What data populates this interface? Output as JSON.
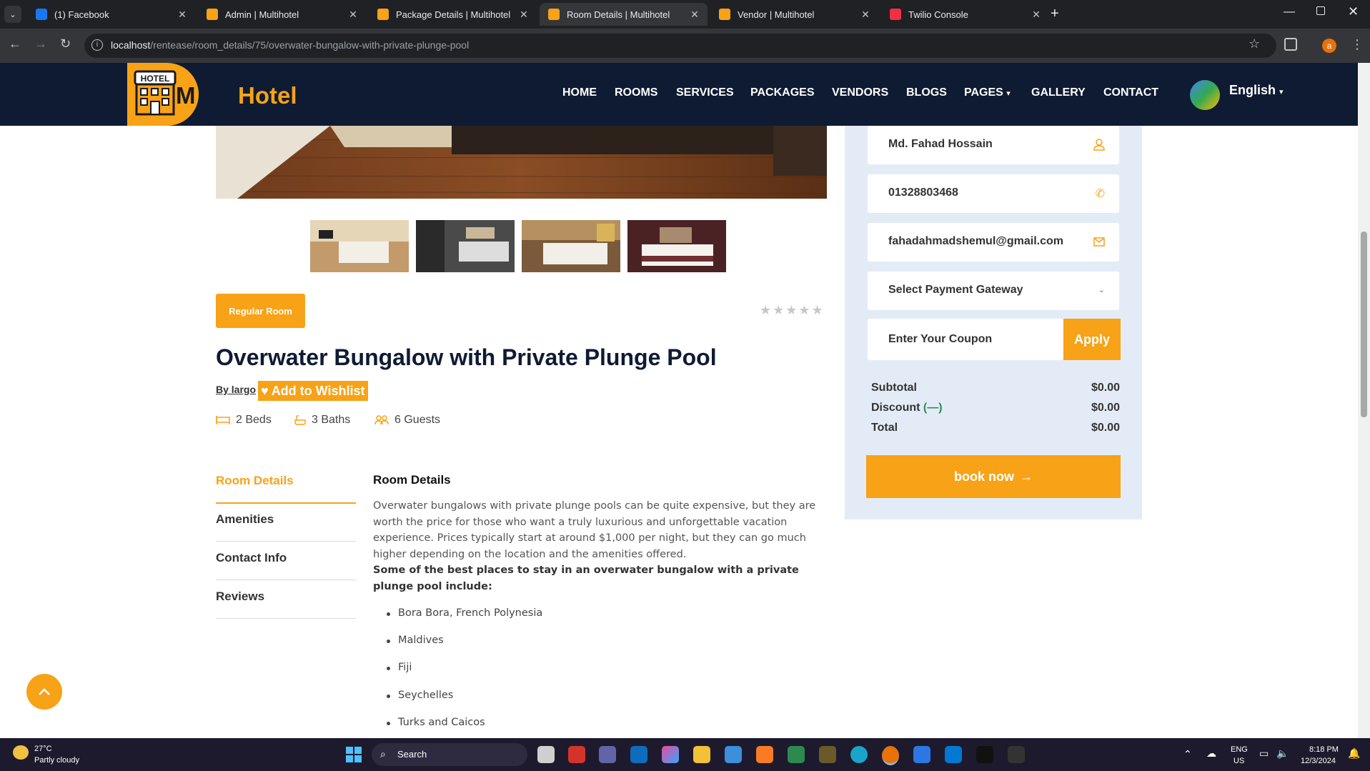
{
  "browser": {
    "tabs": [
      {
        "label": "(1) Facebook",
        "color": "#1877f2"
      },
      {
        "label": "Admin | Multihotel",
        "color": "#f8a217"
      },
      {
        "label": "Package Details | Multihotel",
        "color": "#f8a217"
      },
      {
        "label": "Room Details | Multihotel",
        "color": "#f8a217",
        "active": true
      },
      {
        "label": "Vendor | Multihotel",
        "color": "#f8a217"
      },
      {
        "label": "Twilio Console",
        "color": "#f22f46"
      }
    ],
    "url_host": "localhost",
    "url_path": "/rentease/room_details/75/overwater-bungalow-with-private-plunge-pool",
    "profile_initial": "a"
  },
  "site": {
    "logo_badge": "HOTEL",
    "logo_text": "Hotel",
    "nav": [
      "HOME",
      "ROOMS",
      "SERVICES",
      "PACKAGES",
      "VENDORS",
      "BLOGS",
      "PAGES",
      "GALLERY",
      "CONTACT"
    ],
    "language": "English"
  },
  "room": {
    "category": "Regular Room",
    "title": "Overwater Bungalow with Private Plunge Pool",
    "author": "By largo",
    "wishlist_label": "Add to Wishlist",
    "rating_stars": 0,
    "beds": "2 Beds",
    "baths": "3 Baths",
    "guests": "6 Guests"
  },
  "detail_tabs": [
    "Room Details",
    "Amenities",
    "Contact Info",
    "Reviews"
  ],
  "details": {
    "heading": "Room Details",
    "paragraph": "Overwater bungalows with private plunge pools can be quite expensive, but they are worth the price for those who want a truly luxurious and unforgettable vacation experience. Prices typically start at around $1,000 per night, but they can go much higher depending on the location and the amenities offered.",
    "best_places_heading": "Some of the best places to stay in an overwater bungalow with a private plunge pool include:",
    "places": [
      "Bora Bora, French Polynesia",
      "Maldives",
      "Fiji",
      "Seychelles",
      "Turks and Caicos"
    ]
  },
  "booking": {
    "name": "Md. Fahad Hossain",
    "phone": "01328803468",
    "email": "fahadahmadshemul@gmail.com",
    "gateway_placeholder": "Select Payment Gateway",
    "coupon_placeholder": "Enter Your Coupon",
    "apply_label": "Apply",
    "subtotal_label": "Subtotal",
    "subtotal_value": "$0.00",
    "discount_label": "Discount",
    "discount_value": "$0.00",
    "total_label": "Total",
    "total_value": "$0.00",
    "book_label": "book now"
  },
  "taskbar": {
    "weather_temp": "27°C",
    "weather_desc": "Partly cloudy",
    "search_label": "Search",
    "lang_line1": "ENG",
    "lang_line2": "US",
    "time": "8:18 PM",
    "date": "12/3/2024"
  },
  "colors": {
    "accent": "#f8a217",
    "navy": "#0f1b33",
    "panel": "#e3ecf6"
  }
}
